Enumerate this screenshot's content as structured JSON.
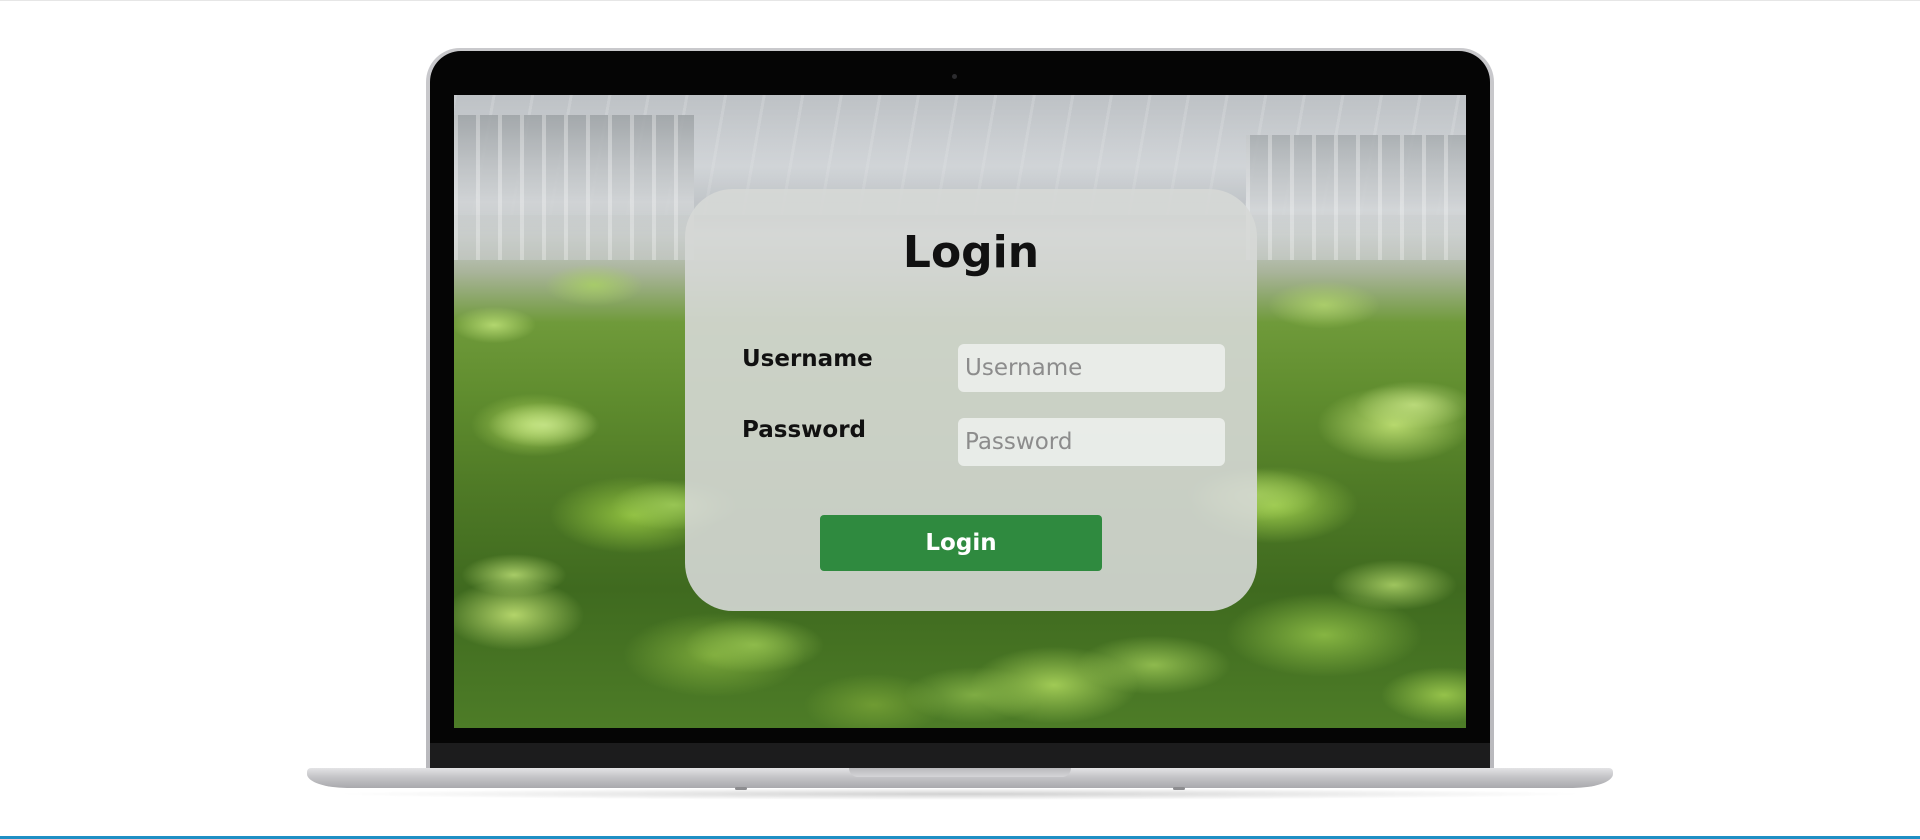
{
  "login": {
    "title": "Login",
    "username_label": "Username",
    "username_value": "",
    "username_placeholder": "Username",
    "password_label": "Password",
    "password_value": "",
    "password_placeholder": "Password",
    "button_label": "Login"
  },
  "colors": {
    "button_background": "#2f8a3f",
    "button_text": "#ffffff",
    "card_background": "#d6d8d6",
    "page_background": "#ffffff",
    "page_bottom_line": "#1f8fc4"
  }
}
